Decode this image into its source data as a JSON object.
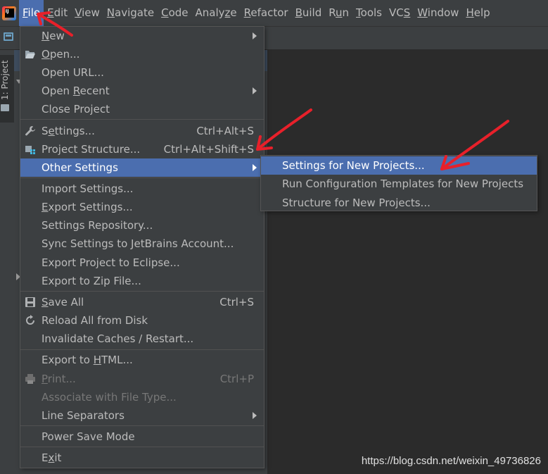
{
  "menubar": {
    "items": [
      {
        "label": "File",
        "mnemonic_index": 0,
        "active": true
      },
      {
        "label": "Edit",
        "mnemonic_index": 0
      },
      {
        "label": "View",
        "mnemonic_index": 0
      },
      {
        "label": "Navigate",
        "mnemonic_index": 0
      },
      {
        "label": "Code",
        "mnemonic_index": 0
      },
      {
        "label": "Analyze",
        "mnemonic_index": 5
      },
      {
        "label": "Refactor",
        "mnemonic_index": 0
      },
      {
        "label": "Build",
        "mnemonic_index": 0
      },
      {
        "label": "Run",
        "mnemonic_index": 1
      },
      {
        "label": "Tools",
        "mnemonic_index": 0
      },
      {
        "label": "VCS",
        "mnemonic_index": 2
      },
      {
        "label": "Window",
        "mnemonic_index": 0
      },
      {
        "label": "Help",
        "mnemonic_index": 0
      }
    ]
  },
  "sidebar": {
    "project_tab_label": "1: Project"
  },
  "file_menu": {
    "items": [
      {
        "type": "item",
        "label": "New",
        "mn_index": 0,
        "submenu": true
      },
      {
        "type": "item",
        "label": "Open...",
        "mn_index": 0,
        "icon": "folder-open-icon"
      },
      {
        "type": "item",
        "label": "Open URL..."
      },
      {
        "type": "item",
        "label": "Open Recent",
        "mn_index": 5,
        "submenu": true
      },
      {
        "type": "item",
        "label": "Close Project"
      },
      {
        "type": "separator"
      },
      {
        "type": "item",
        "label": "Settings...",
        "mn_index": 1,
        "shortcut": "Ctrl+Alt+S",
        "icon": "wrench-icon"
      },
      {
        "type": "item",
        "label": "Project Structure...",
        "shortcut": "Ctrl+Alt+Shift+S",
        "icon": "project-structure-icon"
      },
      {
        "type": "item",
        "label": "Other Settings",
        "submenu": true,
        "selected": true
      },
      {
        "type": "separator"
      },
      {
        "type": "item",
        "label": "Import Settings..."
      },
      {
        "type": "item",
        "label": "Export Settings...",
        "mn_index": 0
      },
      {
        "type": "item",
        "label": "Settings Repository..."
      },
      {
        "type": "item",
        "label": "Sync Settings to JetBrains Account..."
      },
      {
        "type": "item",
        "label": "Export Project to Eclipse..."
      },
      {
        "type": "item",
        "label": "Export to Zip File..."
      },
      {
        "type": "separator"
      },
      {
        "type": "item",
        "label": "Save All",
        "mn_index": 0,
        "shortcut": "Ctrl+S",
        "icon": "save-icon"
      },
      {
        "type": "item",
        "label": "Reload All from Disk",
        "icon": "reload-icon"
      },
      {
        "type": "item",
        "label": "Invalidate Caches / Restart..."
      },
      {
        "type": "separator"
      },
      {
        "type": "item",
        "label": "Export to HTML...",
        "mn_index": 10
      },
      {
        "type": "item",
        "label": "Print...",
        "mn_index": 0,
        "shortcut": "Ctrl+P",
        "disabled": true,
        "icon": "print-icon"
      },
      {
        "type": "item",
        "label": "Associate with File Type...",
        "disabled": true
      },
      {
        "type": "item",
        "label": "Line Separators",
        "submenu": true
      },
      {
        "type": "separator"
      },
      {
        "type": "item",
        "label": "Power Save Mode"
      },
      {
        "type": "separator"
      },
      {
        "type": "item",
        "label": "Exit",
        "mn_index": 1
      }
    ]
  },
  "other_settings_submenu": {
    "items": [
      {
        "label": "Settings for New Projects...",
        "selected": true
      },
      {
        "label": "Run Configuration Templates for New Projects"
      },
      {
        "label": "Structure for New Projects..."
      }
    ]
  },
  "watermark": "https://blog.csdn.net/weixin_49736826",
  "colors": {
    "selection": "#4b6eaf",
    "menu_bg": "#3c3f41",
    "editor_bg": "#2b2b2b",
    "annotation": "#e8202a"
  }
}
